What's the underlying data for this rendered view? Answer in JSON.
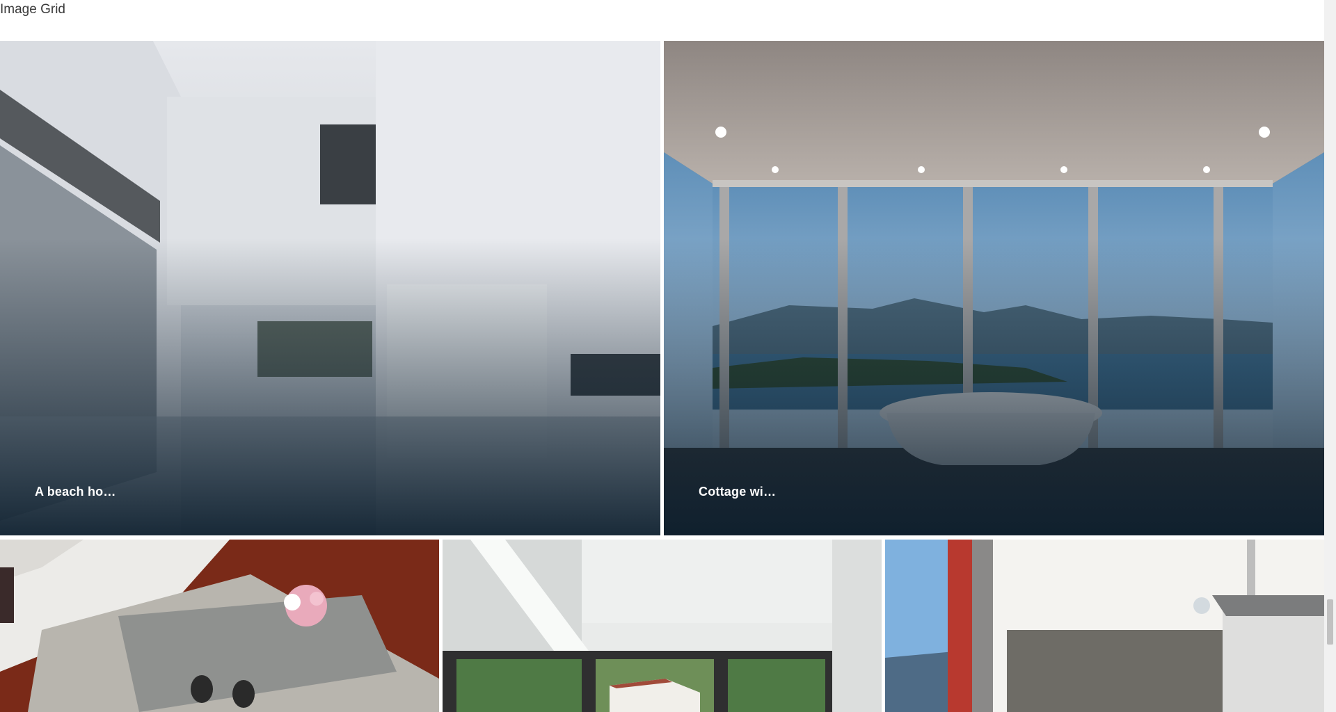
{
  "page": {
    "title": "Image Grid"
  },
  "tiles": [
    {
      "caption": "A beach ho…",
      "scene": "white minimalist interior with kitchen island"
    },
    {
      "caption": "Cottage wi…",
      "scene": "bathroom with freestanding tub and sea view windows"
    },
    {
      "caption": "",
      "scene": "living room with white sofa and glass coffee table"
    },
    {
      "caption": "",
      "scene": "interior with large windows to green hillside"
    },
    {
      "caption": "",
      "scene": "kitchen with stone wall and range hood"
    }
  ],
  "colors": {
    "overlay": "#0c1e2d",
    "caption": "#ffffff",
    "background": "#ffffff"
  },
  "scrollbar": {
    "position_fraction": 0.85
  }
}
